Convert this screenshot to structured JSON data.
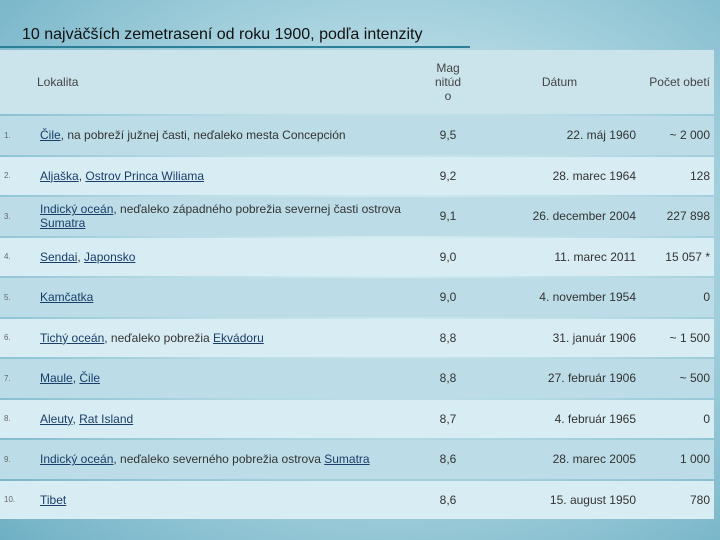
{
  "title": "10 najväčších zemetrasení od roku 1900, podľa intenzity",
  "headers": {
    "location": "Lokalita",
    "magnitude_l1": "Mag",
    "magnitude_l2": "nitúd",
    "magnitude_l3": "o",
    "date": "Dátum",
    "deaths": "Počet obetí"
  },
  "rows": [
    {
      "rank": "1.",
      "location": [
        {
          "text": "Čile",
          "link": true
        },
        {
          "text": ", na pobreží južnej časti, neďaleko mesta Concepción",
          "link": false
        }
      ],
      "magnitude": "9,5",
      "date": "22. máj 1960",
      "deaths": "~ 2 000"
    },
    {
      "rank": "2.",
      "location": [
        {
          "text": "Aljaška",
          "link": true
        },
        {
          "text": ", ",
          "link": false
        },
        {
          "text": "Ostrov Princa Wiliama",
          "link": true
        }
      ],
      "magnitude": "9,2",
      "date": "28. marec 1964",
      "deaths": "128"
    },
    {
      "rank": "3.",
      "location": [
        {
          "text": "Indický oceán",
          "link": true
        },
        {
          "text": ", neďaleko západného pobrežia severnej časti ostrova ",
          "link": false
        },
        {
          "text": "Sumatra",
          "link": true
        }
      ],
      "magnitude": "9,1",
      "date": "26. december 2004",
      "deaths": "227 898"
    },
    {
      "rank": "4.",
      "location": [
        {
          "text": "Sendai",
          "link": true
        },
        {
          "text": ", ",
          "link": false
        },
        {
          "text": "Japonsko",
          "link": true
        }
      ],
      "magnitude": "9,0",
      "date": "11. marec 2011",
      "deaths": "15 057 *"
    },
    {
      "rank": "5.",
      "location": [
        {
          "text": "Kamčatka",
          "link": true
        }
      ],
      "magnitude": "9,0",
      "date": "4. november 1954",
      "deaths": "0"
    },
    {
      "rank": "6.",
      "location": [
        {
          "text": "Tichý oceán",
          "link": true
        },
        {
          "text": ", neďaleko pobrežia ",
          "link": false
        },
        {
          "text": "Ekvádoru",
          "link": true
        }
      ],
      "magnitude": "8,8",
      "date": "31. január 1906",
      "deaths": "~ 1 500"
    },
    {
      "rank": "7.",
      "location": [
        {
          "text": "Maule",
          "link": true
        },
        {
          "text": ", ",
          "link": false
        },
        {
          "text": "Čile",
          "link": true
        }
      ],
      "magnitude": "8,8",
      "date": "27. február 1906",
      "deaths": "~ 500"
    },
    {
      "rank": "8.",
      "location": [
        {
          "text": "Aleuty",
          "link": true
        },
        {
          "text": ", ",
          "link": false
        },
        {
          "text": "Rat Island",
          "link": true
        }
      ],
      "magnitude": "8,7",
      "date": "4. február 1965",
      "deaths": "0"
    },
    {
      "rank": "9.",
      "location": [
        {
          "text": "Indický oceán",
          "link": true
        },
        {
          "text": ", neďaleko severného pobrežia ostrova ",
          "link": false
        },
        {
          "text": "Sumatra",
          "link": true
        }
      ],
      "magnitude": "8,6",
      "date": "28. marec 2005",
      "deaths": "1 000"
    },
    {
      "rank": "10.",
      "location": [
        {
          "text": "Tibet",
          "link": true
        }
      ],
      "magnitude": "8,6",
      "date": "15. august 1950",
      "deaths": "780"
    }
  ]
}
